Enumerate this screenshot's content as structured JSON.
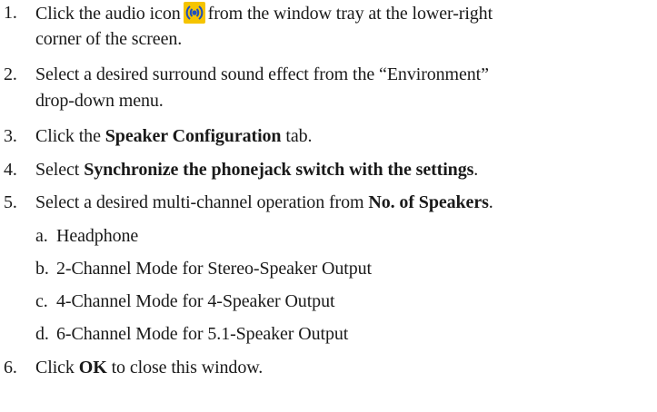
{
  "steps": [
    {
      "number": "1.",
      "before_icon": "Click the audio icon",
      "icon": "audio-speaker-icon",
      "after_icon": "from the window tray at the lower-right",
      "continuation": "corner of the screen."
    },
    {
      "number": "2.",
      "text": "Select a desired surround sound effect from the “Environment”",
      "continuation": "drop-down menu."
    },
    {
      "number": "3.",
      "prefix": "Click the",
      "bold": "Speaker Configuration",
      "suffix": "tab."
    },
    {
      "number": "4.",
      "prefix": "Select",
      "bold": "Synchronize the phonejack switch with the settings",
      "suffix": "."
    },
    {
      "number": "5.",
      "prefix": "Select a desired multi-channel operation from",
      "bold": "No. of Speakers",
      "suffix": ".",
      "options": [
        {
          "letter": "a.",
          "text": "Headphone"
        },
        {
          "letter": "b.",
          "text": "2-Channel Mode for Stereo-Speaker Output"
        },
        {
          "letter": "c.",
          "text": "4-Channel Mode for 4-Speaker Output"
        },
        {
          "letter": "d.",
          "text": "6-Channel Mode for 5.1-Speaker Output"
        }
      ]
    },
    {
      "number": "6.",
      "prefix": "Click",
      "bold": "OK",
      "suffix": "to close this window."
    }
  ],
  "colors": {
    "text": "#1a1a1a",
    "icon_background": "#f5c400",
    "icon_center": "#1f4fbf"
  }
}
